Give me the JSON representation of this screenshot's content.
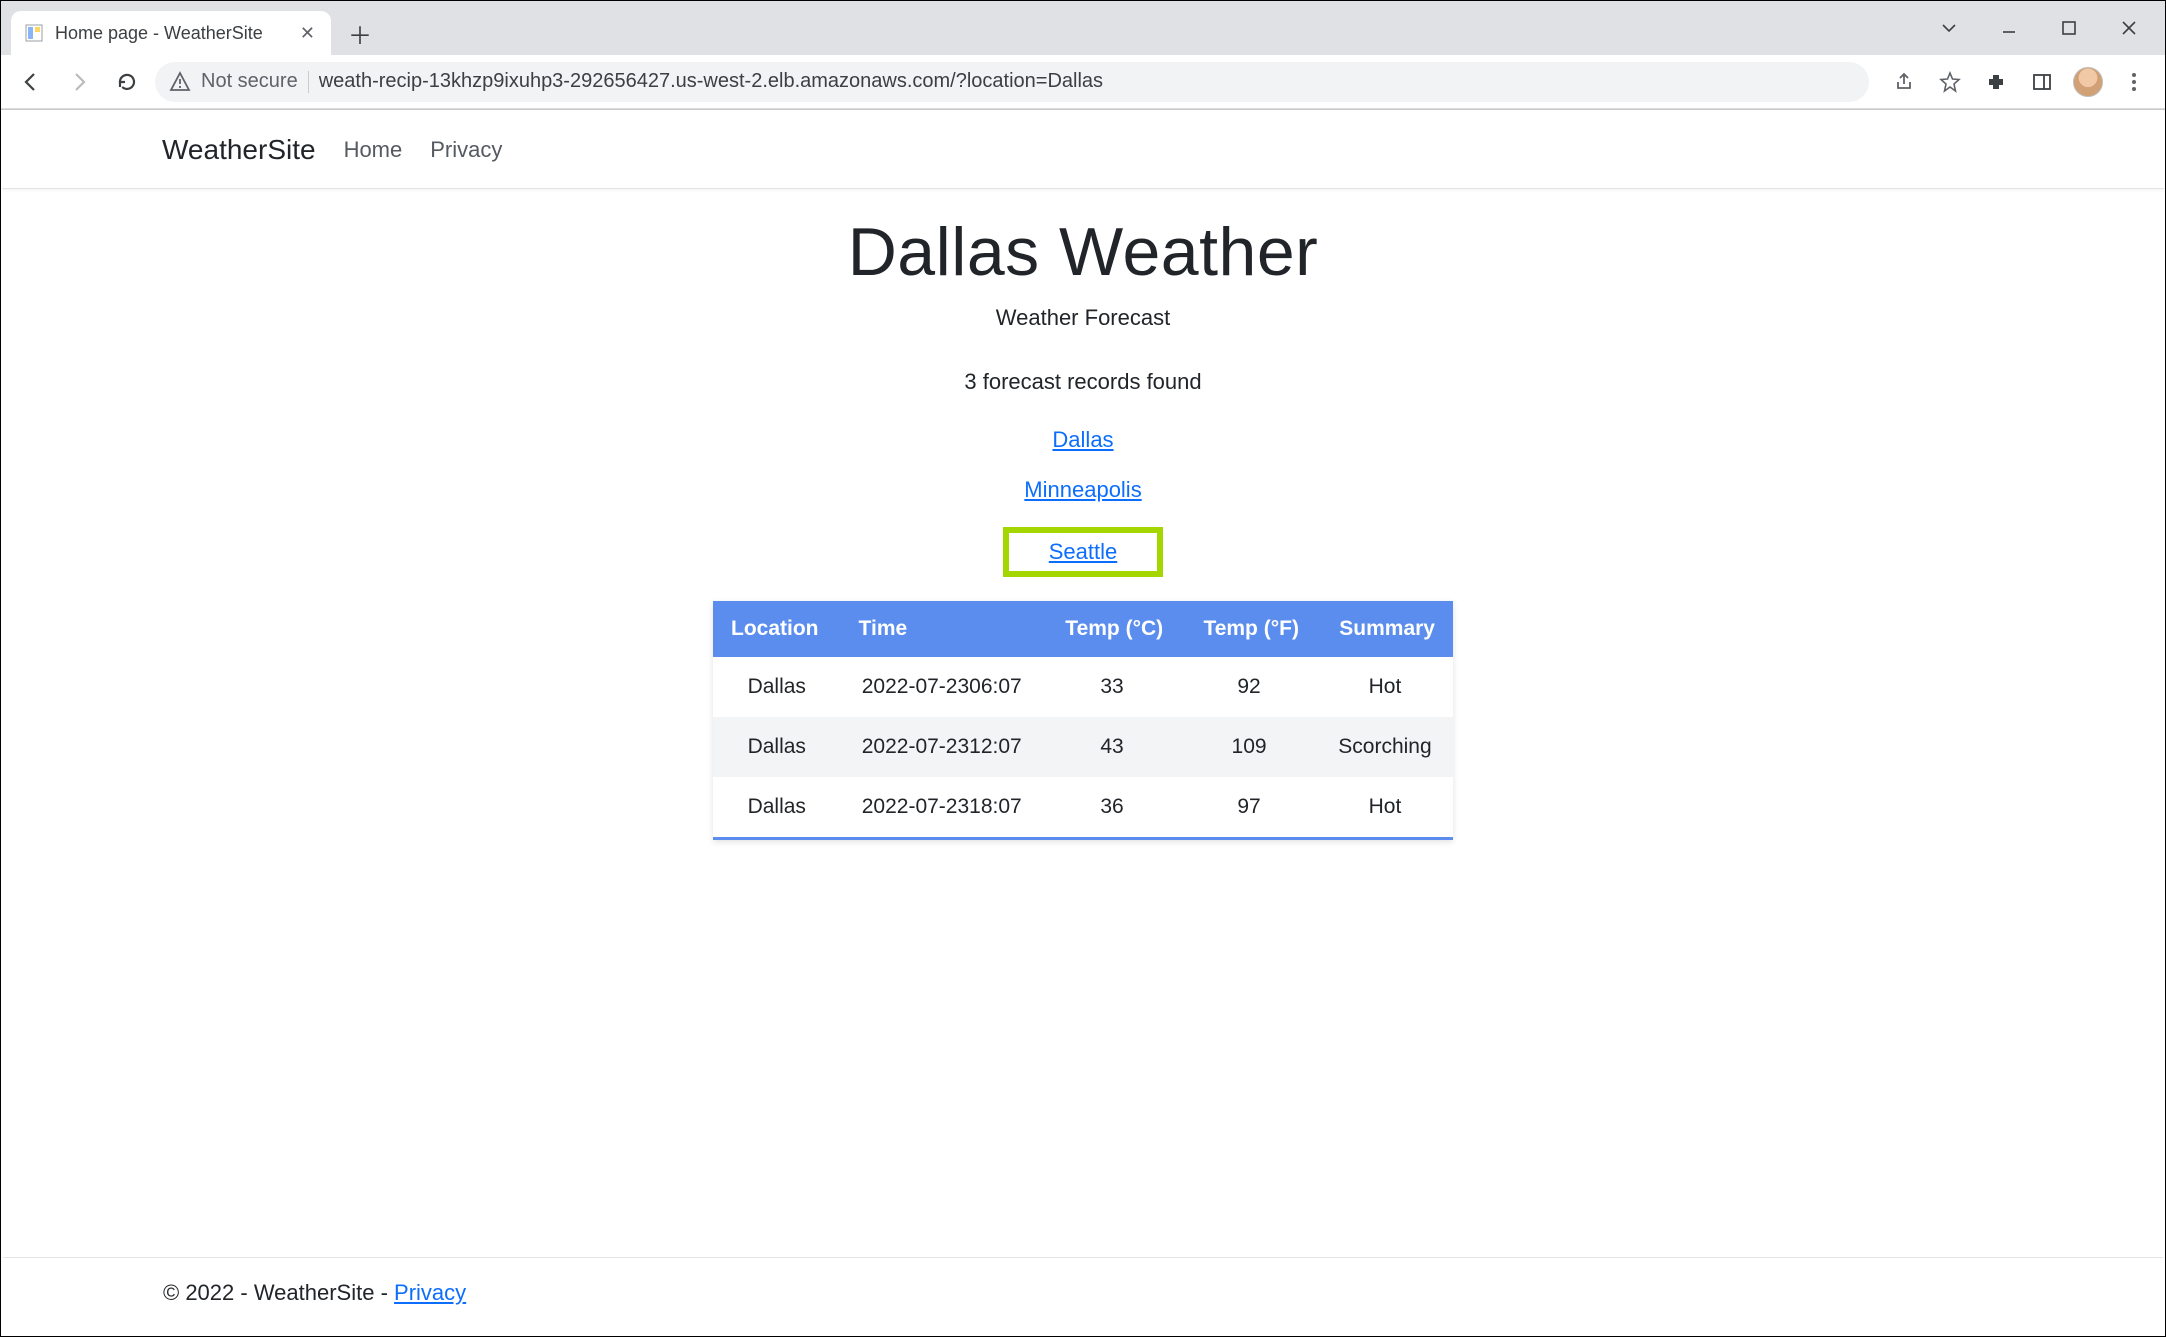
{
  "browser": {
    "tab_title": "Home page - WeatherSite",
    "not_secure_label": "Not secure",
    "url": "weath-recip-13khzp9ixuhp3-292656427.us-west-2.elb.amazonaws.com/?location=Dallas"
  },
  "nav": {
    "brand": "WeatherSite",
    "links": [
      "Home",
      "Privacy"
    ]
  },
  "page": {
    "title": "Dallas Weather",
    "subtitle": "Weather Forecast",
    "records_found": "3 forecast records found",
    "city_links": [
      "Dallas",
      "Minneapolis",
      "Seattle"
    ],
    "highlighted_city_index": 2
  },
  "table": {
    "headers": {
      "location": "Location",
      "time": "Time",
      "temp_c": "Temp (°C)",
      "temp_f": "Temp (°F)",
      "summary": "Summary"
    },
    "rows": [
      {
        "location": "Dallas",
        "time": "2022-07-2306:07",
        "temp_c": "33",
        "temp_f": "92",
        "summary": "Hot"
      },
      {
        "location": "Dallas",
        "time": "2022-07-2312:07",
        "temp_c": "43",
        "temp_f": "109",
        "summary": "Scorching"
      },
      {
        "location": "Dallas",
        "time": "2022-07-2318:07",
        "temp_c": "36",
        "temp_f": "97",
        "summary": "Hot"
      }
    ]
  },
  "footer": {
    "text": "© 2022 - WeatherSite - ",
    "privacy": "Privacy"
  }
}
